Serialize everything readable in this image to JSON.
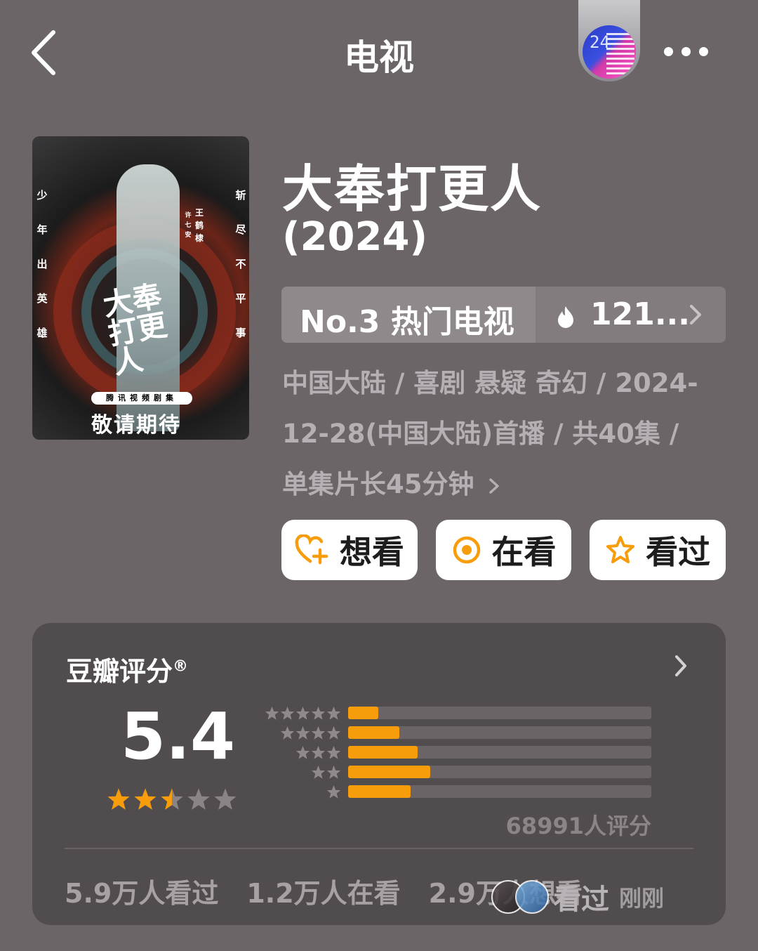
{
  "header": {
    "title": "电视",
    "badge_text": "24"
  },
  "poster": {
    "left_vertical": [
      "少",
      "年",
      "出",
      "英",
      "雄"
    ],
    "right_vertical": [
      "斩",
      "尽",
      "不",
      "平",
      "事"
    ],
    "cast_text": [
      "王",
      "鹤",
      "棣"
    ],
    "cast_small": [
      "许",
      "七",
      "安"
    ],
    "calligraphy_title": "大奉打更人",
    "platform_strip": "腾讯视频剧集",
    "coming_text": "敬请期待"
  },
  "show": {
    "title": "大奉打更人",
    "year": "(2024)"
  },
  "ranking": {
    "rank_text": "No.3 热门电视",
    "heat_text": "121..."
  },
  "meta": {
    "line": "中国大陆 / 喜剧 悬疑 奇幻 / 2024-12-28(中国大陆)首播 / 共40集 / 单集片长45分钟"
  },
  "actions": [
    {
      "label": "想看",
      "icon": "heart-plus-icon"
    },
    {
      "label": "在看",
      "icon": "target-icon"
    },
    {
      "label": "看过",
      "icon": "star-outline-icon"
    }
  ],
  "rating": {
    "header": "豆瓣评分",
    "registered": "®",
    "score": "5.4",
    "stars_value": 2.5,
    "stars_max": 5,
    "distribution": [
      {
        "stars": 5,
        "fraction": 0.1
      },
      {
        "stars": 4,
        "fraction": 0.17
      },
      {
        "stars": 3,
        "fraction": 0.23
      },
      {
        "stars": 2,
        "fraction": 0.27
      },
      {
        "stars": 1,
        "fraction": 0.205
      }
    ],
    "count_text": "68991人评分",
    "stats": [
      "5.9万人看过",
      "1.2万人在看",
      "2.9万人想看"
    ]
  },
  "toast": {
    "text": "看过",
    "time": "刚刚"
  },
  "colors": {
    "background": "#6b6568",
    "card": "#514c4e",
    "accent": "#f79d0b",
    "muted_text": "#b5b0b3"
  }
}
